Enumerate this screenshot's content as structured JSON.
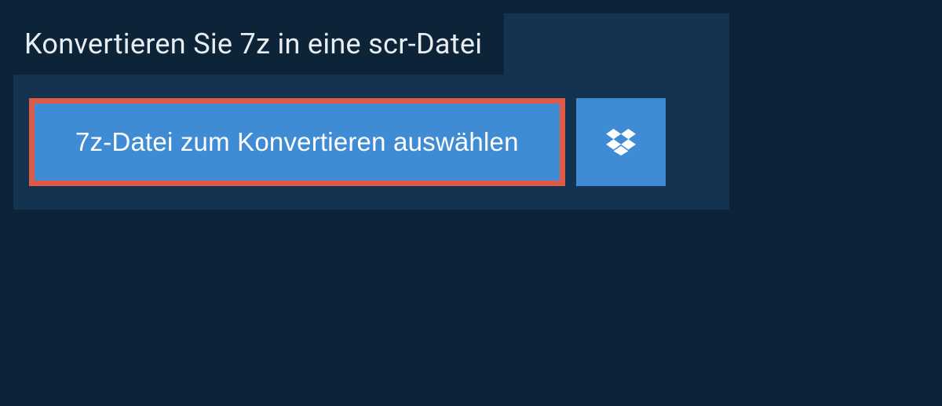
{
  "header": {
    "title": "Konvertieren Sie 7z in eine scr-Datei"
  },
  "actions": {
    "select_file_label": "7z-Datei zum Konvertieren auswählen",
    "dropbox_icon_name": "dropbox-icon"
  },
  "colors": {
    "page_bg": "#0d2438",
    "panel_bg": "#133351",
    "button_bg": "#3f8cd5",
    "highlight_border": "#e05a48",
    "text_light": "#e8edf2"
  }
}
